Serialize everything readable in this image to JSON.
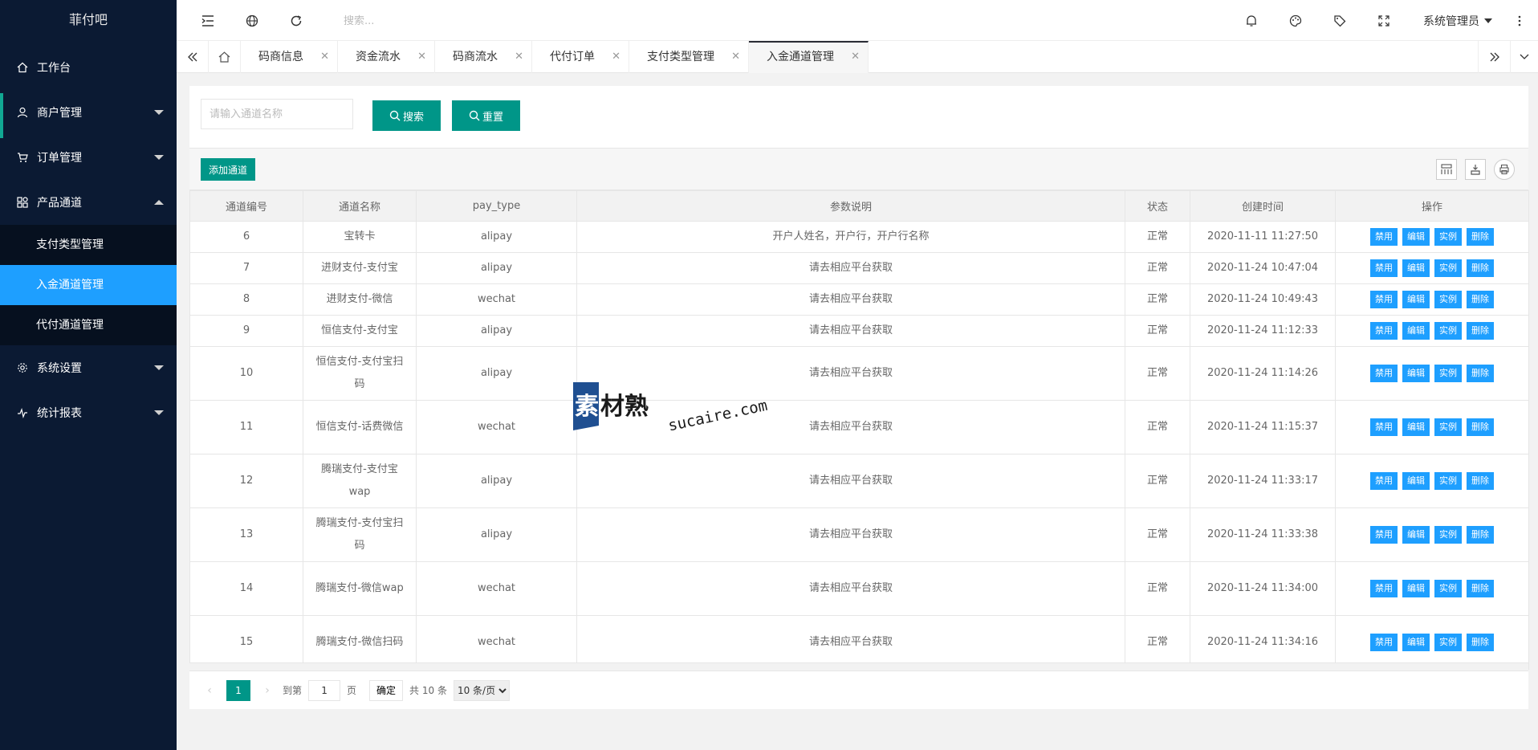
{
  "app": {
    "logo": "菲付吧"
  },
  "sidebar": {
    "items": [
      {
        "label": "工作台"
      },
      {
        "label": "商户管理"
      },
      {
        "label": "订单管理"
      },
      {
        "label": "产品通道"
      },
      {
        "label": "系统设置"
      },
      {
        "label": "统计报表"
      }
    ],
    "sub_items": [
      {
        "label": "支付类型管理"
      },
      {
        "label": "入金通道管理"
      },
      {
        "label": "代付通道管理"
      }
    ]
  },
  "header": {
    "search_placeholder": "搜索...",
    "user": "系统管理员"
  },
  "tabs": [
    {
      "label": "码商信息"
    },
    {
      "label": "资金流水"
    },
    {
      "label": "码商流水"
    },
    {
      "label": "代付订单"
    },
    {
      "label": "支付类型管理"
    },
    {
      "label": "入金通道管理"
    }
  ],
  "filter": {
    "placeholder": "请输入通道名称",
    "search_label": "搜索",
    "reset_label": "重置"
  },
  "toolbar": {
    "add_label": "添加通道"
  },
  "table": {
    "columns": [
      "通道编号",
      "通道名称",
      "pay_type",
      "参数说明",
      "状态",
      "创建时间",
      "操作"
    ],
    "rows": [
      {
        "id": "6",
        "name": "宝转卡",
        "pay_type": "alipay",
        "desc": "开户人姓名，开户行，开户行名称",
        "status": "正常",
        "created": "2020-11-11 11:27:50"
      },
      {
        "id": "7",
        "name": "进财支付-支付宝",
        "pay_type": "alipay",
        "desc": "请去相应平台获取",
        "status": "正常",
        "created": "2020-11-24 10:47:04"
      },
      {
        "id": "8",
        "name": "进财支付-微信",
        "pay_type": "wechat",
        "desc": "请去相应平台获取",
        "status": "正常",
        "created": "2020-11-24 10:49:43"
      },
      {
        "id": "9",
        "name": "恒信支付-支付宝",
        "pay_type": "alipay",
        "desc": "请去相应平台获取",
        "status": "正常",
        "created": "2020-11-24 11:12:33"
      },
      {
        "id": "10",
        "name": "恒信支付-支付宝扫码",
        "pay_type": "alipay",
        "desc": "请去相应平台获取",
        "status": "正常",
        "created": "2020-11-24 11:14:26"
      },
      {
        "id": "11",
        "name": "恒信支付-话费微信",
        "pay_type": "wechat",
        "desc": "请去相应平台获取",
        "status": "正常",
        "created": "2020-11-24 11:15:37"
      },
      {
        "id": "12",
        "name": "腾瑞支付-支付宝wap",
        "pay_type": "alipay",
        "desc": "请去相应平台获取",
        "status": "正常",
        "created": "2020-11-24 11:33:17"
      },
      {
        "id": "13",
        "name": "腾瑞支付-支付宝扫码",
        "pay_type": "alipay",
        "desc": "请去相应平台获取",
        "status": "正常",
        "created": "2020-11-24 11:33:38"
      },
      {
        "id": "14",
        "name": "腾瑞支付-微信wap",
        "pay_type": "wechat",
        "desc": "请去相应平台获取",
        "status": "正常",
        "created": "2020-11-24 11:34:00"
      },
      {
        "id": "15",
        "name": "腾瑞支付-微信扫码",
        "pay_type": "wechat",
        "desc": "请去相应平台获取",
        "status": "正常",
        "created": "2020-11-24 11:34:16"
      }
    ],
    "actions": [
      "禁用",
      "编辑",
      "实例",
      "删除"
    ]
  },
  "pager": {
    "current": "1",
    "goto_label": "到第",
    "goto_value": "1",
    "page_unit": "页",
    "confirm": "确定",
    "total": "共 10 条",
    "page_size": "10 条/页"
  },
  "watermark": {
    "cn": "素材熟",
    "en": "sucaire.com"
  },
  "colors": {
    "sidebar": "#0b1a33",
    "active": "#1e9fff",
    "teal": "#009688"
  }
}
